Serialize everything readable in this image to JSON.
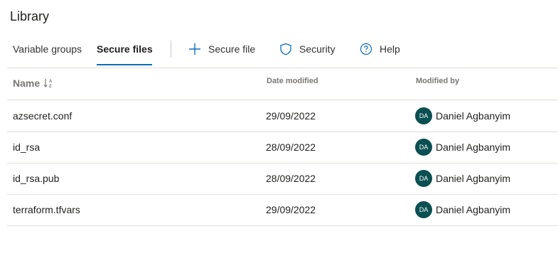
{
  "page": {
    "title": "Library"
  },
  "tabs": {
    "variable_groups": "Variable groups",
    "secure_files": "Secure files"
  },
  "commands": {
    "add_secure_file": "Secure file",
    "security": "Security",
    "help": "Help"
  },
  "table": {
    "columns": {
      "name": "Name",
      "date_modified": "Date modified",
      "modified_by": "Modified by"
    },
    "rows": [
      {
        "name": "azsecret.conf",
        "date": "29/09/2022",
        "initials": "DA",
        "user": "Daniel Agbanyim"
      },
      {
        "name": "id_rsa",
        "date": "28/09/2022",
        "initials": "DA",
        "user": "Daniel Agbanyim"
      },
      {
        "name": "id_rsa.pub",
        "date": "28/09/2022",
        "initials": "DA",
        "user": "Daniel Agbanyim"
      },
      {
        "name": "terraform.tfvars",
        "date": "29/09/2022",
        "initials": "DA",
        "user": "Daniel Agbanyim"
      }
    ]
  },
  "colors": {
    "accent": "#0f6cbd",
    "avatar": "#0a4f52"
  },
  "icons": {
    "add": "plus-icon",
    "security": "shield-icon",
    "help": "help-circle-icon",
    "sort": "sort-az-icon"
  }
}
